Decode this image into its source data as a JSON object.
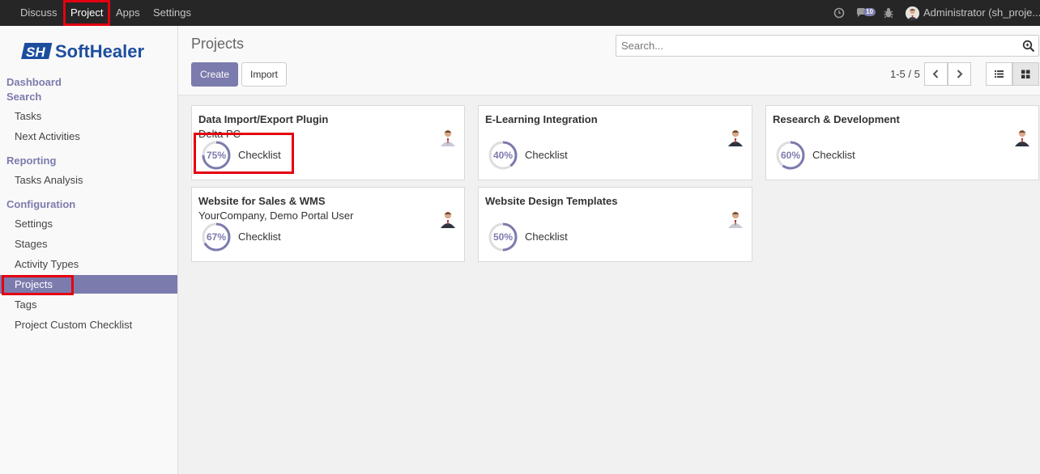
{
  "topbar": {
    "menus": [
      "Discuss",
      "Project",
      "Apps",
      "Settings"
    ],
    "active_menu": "Project",
    "chat_count": "10",
    "user": "Administrator (sh_proje...",
    "icons": [
      "clock-icon",
      "chat-icon",
      "bug-icon"
    ]
  },
  "sidebar": {
    "logo": "SoftHealer",
    "sections": {
      "dashboard": "Dashboard",
      "search": "Search",
      "reporting": "Reporting",
      "configuration": "Configuration"
    },
    "items": {
      "tasks": "Tasks",
      "next_activities": "Next Activities",
      "tasks_analysis": "Tasks Analysis",
      "settings": "Settings",
      "stages": "Stages",
      "activity_types": "Activity Types",
      "projects": "Projects",
      "tags": "Tags",
      "custom_checklist": "Project Custom Checklist"
    },
    "active_item": "Projects"
  },
  "control_panel": {
    "title": "Projects",
    "search_placeholder": "Search...",
    "create_label": "Create",
    "import_label": "Import",
    "pager": "1-5 / 5",
    "view_mode": "kanban"
  },
  "projects": [
    {
      "name": "Data Import/Export Plugin",
      "partner": "Delta PC",
      "progress": "75%",
      "progress_value": 75,
      "checklist_label": "Checklist"
    },
    {
      "name": "E-Learning Integration",
      "partner": "",
      "progress": "40%",
      "progress_value": 40,
      "checklist_label": "Checklist"
    },
    {
      "name": "Research & Development",
      "partner": "",
      "progress": "60%",
      "progress_value": 60,
      "checklist_label": "Checklist"
    },
    {
      "name": "Website for Sales & WMS",
      "partner": "YourCompany, Demo Portal User",
      "progress": "67%",
      "progress_value": 67,
      "checklist_label": "Checklist"
    },
    {
      "name": "Website Design Templates",
      "partner": "",
      "progress": "50%",
      "progress_value": 50,
      "checklist_label": "Checklist"
    }
  ],
  "colors": {
    "accent": "#7c7bad",
    "highlight": "#e4000f",
    "topbar": "#262626"
  }
}
